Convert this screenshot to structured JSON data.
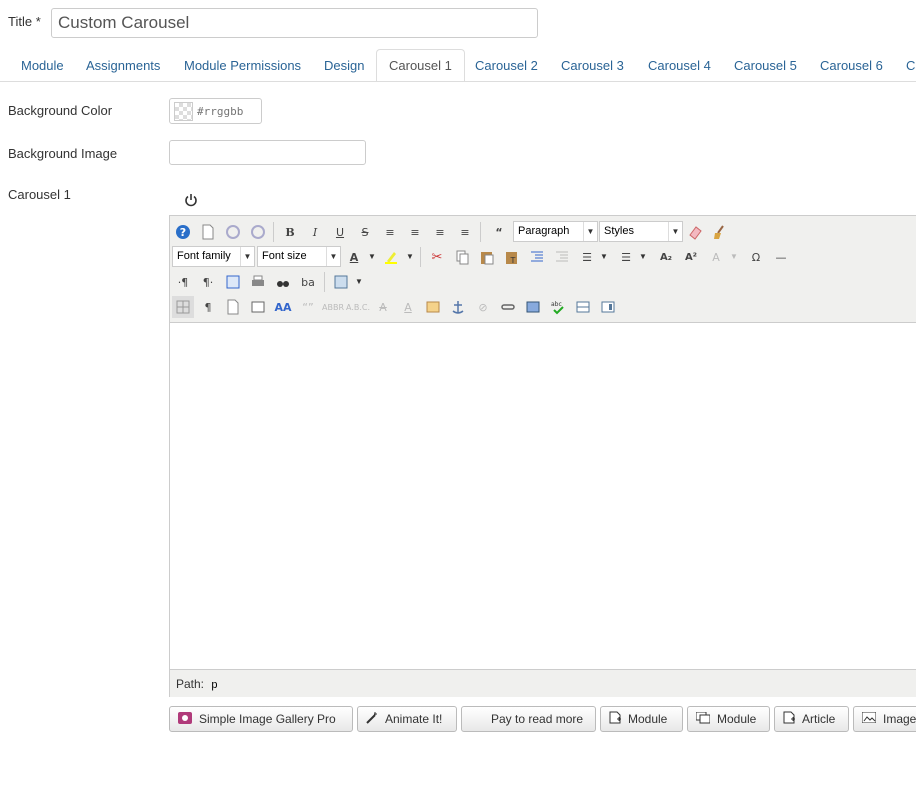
{
  "title_field": {
    "label": "Title *",
    "value": "Custom Carousel"
  },
  "tabs": [
    {
      "label": "Module"
    },
    {
      "label": "Assignments"
    },
    {
      "label": "Module Permissions"
    },
    {
      "label": "Design"
    },
    {
      "label": "Carousel 1",
      "active": true
    },
    {
      "label": "Carousel 2"
    },
    {
      "label": "Carousel 3"
    },
    {
      "label": "Carousel 4"
    },
    {
      "label": "Carousel 5"
    },
    {
      "label": "Carousel 6"
    },
    {
      "label": "Ca"
    }
  ],
  "fields": {
    "background_color": {
      "label": "Background Color",
      "placeholder": "#rrggbb",
      "value": ""
    },
    "background_image": {
      "label": "Background Image",
      "value": ""
    },
    "carousel": {
      "label": "Carousel 1"
    }
  },
  "editor": {
    "format_select": "Paragraph",
    "styles_select": "Styles",
    "font_family_select": "Font family",
    "font_size_select": "Font size",
    "path_label": "Path:",
    "path_value": "p"
  },
  "buttons": [
    {
      "label": "Simple Image Gallery Pro",
      "icon": "image-gallery-icon"
    },
    {
      "label": "Animate It!",
      "icon": "magic-wand-icon"
    },
    {
      "label": "Pay to read more",
      "icon": ""
    },
    {
      "label": "Module",
      "icon": "module-insert-icon"
    },
    {
      "label": "Module",
      "icon": "module-position-icon"
    },
    {
      "label": "Article",
      "icon": "article-icon"
    },
    {
      "label": "Image",
      "icon": "image-icon"
    }
  ],
  "colors": {
    "link": "#2a6496",
    "toolbar_bg": "#f0f0ee",
    "border": "#cccccc"
  }
}
